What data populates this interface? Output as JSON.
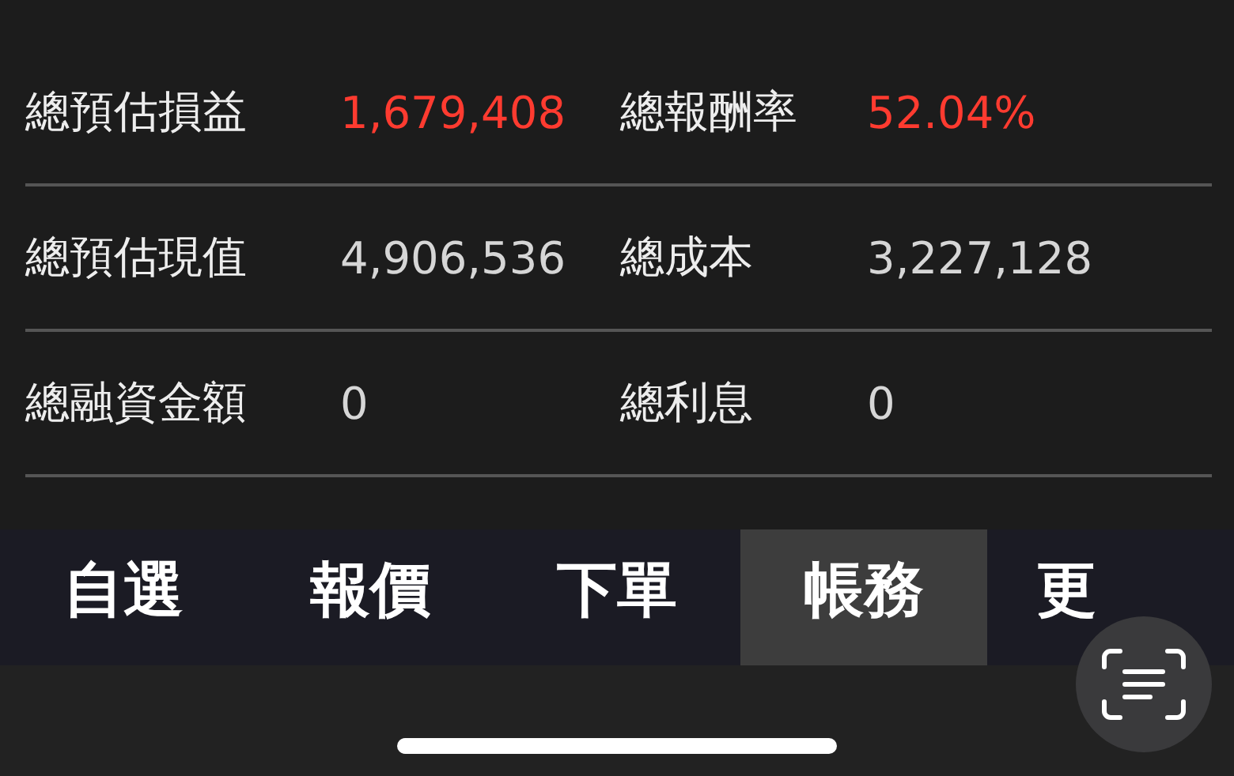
{
  "summary_rows": [
    {
      "items": [
        {
          "label": "總預估損益",
          "value": "1,679,408",
          "color": "#ff3b30"
        },
        {
          "label": "總報酬率",
          "value": "52.04%",
          "color": "#ff3b30"
        }
      ]
    },
    {
      "items": [
        {
          "label": "總預估現值",
          "value": "4,906,536",
          "color": "#d6d6d6"
        },
        {
          "label": "總成本",
          "value": "3,227,128",
          "color": "#d6d6d6"
        }
      ]
    },
    {
      "items": [
        {
          "label": "總融資金額",
          "value": "0",
          "color": "#d6d6d6"
        },
        {
          "label": "總利息",
          "value": "0",
          "color": "#d6d6d6"
        }
      ]
    }
  ],
  "tabs": [
    {
      "label": "自選",
      "selected": false
    },
    {
      "label": "報價",
      "selected": false
    },
    {
      "label": "下單",
      "selected": false
    },
    {
      "label": "帳務",
      "selected": true
    },
    {
      "label": "更",
      "selected": false
    }
  ]
}
